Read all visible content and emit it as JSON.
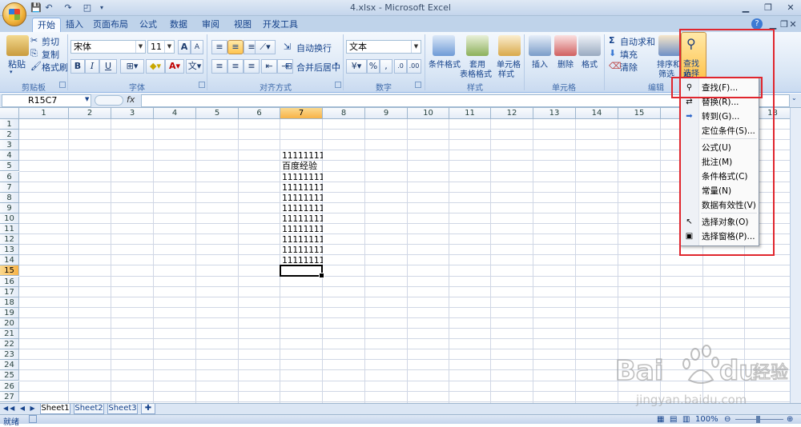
{
  "window": {
    "title": "4.xlsx - Microsoft Excel"
  },
  "tabs": [
    {
      "label": "开始",
      "active": true
    },
    {
      "label": "插入"
    },
    {
      "label": "页面布局"
    },
    {
      "label": "公式"
    },
    {
      "label": "数据"
    },
    {
      "label": "审阅"
    },
    {
      "label": "视图"
    },
    {
      "label": "开发工具"
    }
  ],
  "ribbon": {
    "clipboard": {
      "paste": "粘贴",
      "cut": "剪切",
      "copy": "复制",
      "format_painter": "格式刷",
      "label": "剪贴板"
    },
    "font": {
      "name": "宋体",
      "size": "11",
      "bold": "B",
      "italic": "I",
      "underline": "U",
      "grow": "A",
      "shrink": "A",
      "label": "字体"
    },
    "alignment": {
      "wrap": "自动换行",
      "merge": "合并后居中",
      "label": "对齐方式"
    },
    "number": {
      "format": "文本",
      "percent": "%",
      "comma": ",",
      "label": "数字"
    },
    "styles": {
      "conditional": "条件格式",
      "table_format_1": "套用",
      "table_format_2": "表格格式",
      "cell_style_1": "单元格",
      "cell_style_2": "样式",
      "label": "样式"
    },
    "cells": {
      "insert": "插入",
      "delete": "删除",
      "format": "格式",
      "label": "单元格"
    },
    "editing": {
      "autosum": "自动求和",
      "fill": "填充",
      "clear": "清除",
      "sort_1": "排序和",
      "sort_2": "筛选",
      "find_1": "查找和",
      "find_2": "选择",
      "label": "编辑"
    }
  },
  "formula_bar": {
    "name_box": "R15C7",
    "fx": "fx",
    "value": ""
  },
  "grid": {
    "columns": [
      "1",
      "2",
      "3",
      "4",
      "5",
      "6",
      "7",
      "8",
      "9",
      "10",
      "11",
      "12",
      "13",
      "14",
      "15",
      "",
      "",
      "18"
    ],
    "rows": [
      "1",
      "2",
      "3",
      "4",
      "5",
      "6",
      "7",
      "8",
      "9",
      "10",
      "11",
      "12",
      "13",
      "14",
      "15",
      "16",
      "17",
      "18",
      "19",
      "20",
      "21",
      "22",
      "23",
      "24",
      "25",
      "26",
      "27"
    ],
    "selected_col": "7",
    "selected_row": "15",
    "cells": [
      {
        "row": 4,
        "col": 7,
        "value": "11111111"
      },
      {
        "row": 5,
        "col": 7,
        "value": "百度经验"
      },
      {
        "row": 6,
        "col": 7,
        "value": "11111111"
      },
      {
        "row": 7,
        "col": 7,
        "value": "11111111"
      },
      {
        "row": 8,
        "col": 7,
        "value": "11111111"
      },
      {
        "row": 9,
        "col": 7,
        "value": "11111111"
      },
      {
        "row": 10,
        "col": 7,
        "value": "11111111"
      },
      {
        "row": 11,
        "col": 7,
        "value": "11111111"
      },
      {
        "row": 12,
        "col": 7,
        "value": "11111111"
      },
      {
        "row": 13,
        "col": 7,
        "value": "11111111"
      },
      {
        "row": 14,
        "col": 7,
        "value": "11111111"
      }
    ]
  },
  "find_menu": {
    "items": [
      {
        "label": "查找(F)...",
        "icon": "binoculars-icon"
      },
      {
        "label": "替换(R)...",
        "icon": "replace-icon"
      },
      {
        "label": "转到(G)...",
        "icon": "arrow-right-icon"
      },
      {
        "label": "定位条件(S)...",
        "icon": ""
      },
      {
        "label": "公式(U)",
        "icon": ""
      },
      {
        "label": "批注(M)",
        "icon": ""
      },
      {
        "label": "条件格式(C)",
        "icon": ""
      },
      {
        "label": "常量(N)",
        "icon": ""
      },
      {
        "label": "数据有效性(V)",
        "icon": ""
      },
      {
        "label": "选择对象(O)",
        "icon": "pointer-icon"
      },
      {
        "label": "选择窗格(P)...",
        "icon": "selection-pane-icon"
      }
    ]
  },
  "sheets": [
    {
      "label": "Sheet1",
      "active": true
    },
    {
      "label": "Sheet2"
    },
    {
      "label": "Sheet3"
    }
  ],
  "status": {
    "mode": "就绪",
    "zoom": "100%"
  },
  "watermark": {
    "text_1": "Bai",
    "text_2": "du",
    "text_3": "经验",
    "url": "jingyan.baidu.com"
  }
}
